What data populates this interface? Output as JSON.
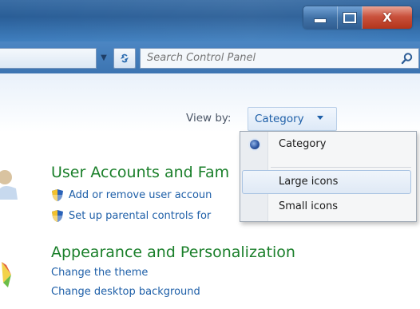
{
  "window": {
    "caption_buttons": {
      "minimize_icon": "minimize-icon",
      "maximize_icon": "maximize-icon",
      "close_glyph": "X"
    }
  },
  "navbar": {
    "search_placeholder": "Search Control Panel",
    "refresh_icon": "refresh-icon",
    "search_icon": "search-icon"
  },
  "view_by": {
    "label": "View by:",
    "selected": "Category",
    "options": [
      {
        "label": "Category",
        "selected": true
      },
      {
        "label": "Large icons",
        "selected": false
      },
      {
        "label": "Small icons",
        "selected": false
      }
    ]
  },
  "categories": [
    {
      "title": "User Accounts and Fam",
      "icon": "user-accounts-icon",
      "links": [
        {
          "label": "Add or remove user accoun",
          "shield": true
        },
        {
          "label": "Set up parental controls for",
          "shield": true
        }
      ]
    },
    {
      "title": "Appearance and Personalization",
      "icon": "appearance-icon",
      "links": [
        {
          "label": "Change the theme",
          "shield": false
        },
        {
          "label": "Change desktop background",
          "shield": false
        }
      ]
    }
  ],
  "colors": {
    "link": "#1e5fa8",
    "category_title": "#1a7f2a",
    "titlebar": "#2a5e97"
  }
}
